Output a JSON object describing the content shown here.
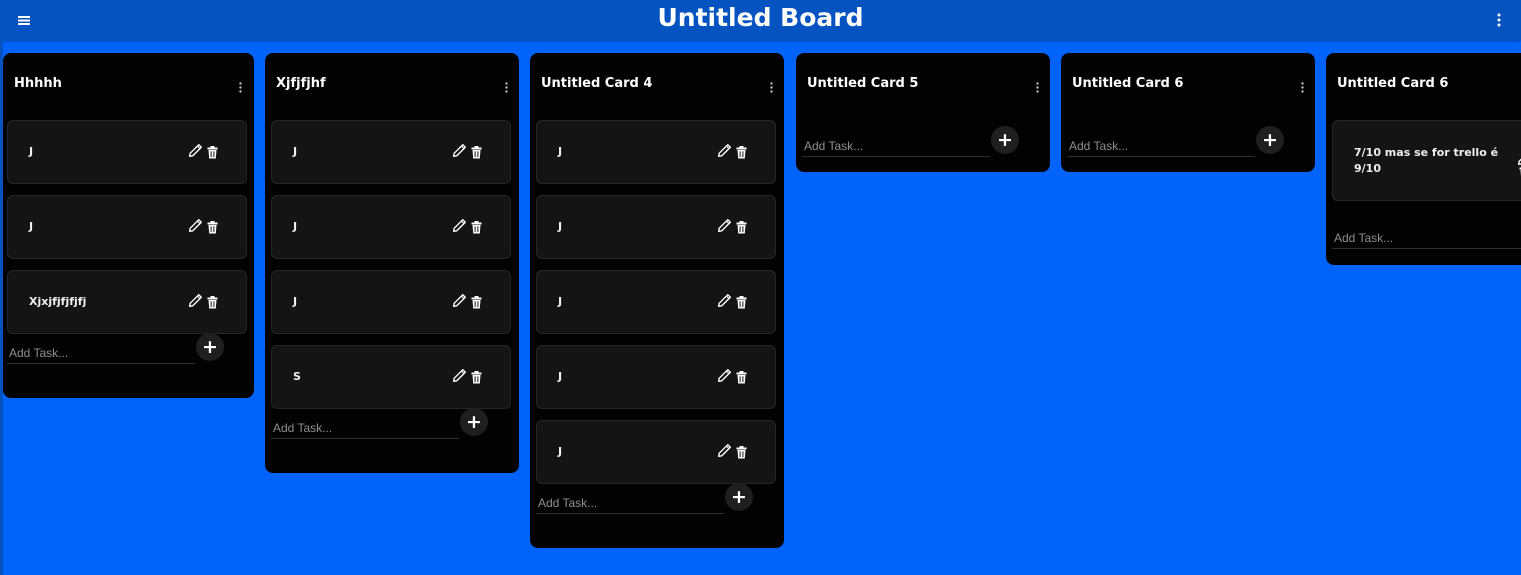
{
  "board": {
    "title": "Untitled Board",
    "menu_icon": "hamburger-icon",
    "options_icon": "kebab-vertical-icon",
    "background": "#0064fb",
    "header_color": "#0453c0"
  },
  "columns": [
    {
      "title": "Hhhhh",
      "tasks": [
        "J",
        "J",
        "Xjxjfjfjfjfj"
      ],
      "add_placeholder": "Add Task..."
    },
    {
      "title": "Xjfjfjhf",
      "tasks": [
        "J",
        "J",
        "J",
        "S"
      ],
      "add_placeholder": "Add Task..."
    },
    {
      "title": "Untitled Card 4",
      "tasks": [
        "J",
        "J",
        "J",
        "J",
        "J"
      ],
      "add_placeholder": "Add Task..."
    },
    {
      "title": "Untitled Card 5",
      "tasks": [],
      "add_placeholder": "Add Task..."
    },
    {
      "title": "Untitled Card 6",
      "tasks": [],
      "add_placeholder": "Add Task..."
    },
    {
      "title": "Untitled Card 6",
      "tasks": [
        "7/10 mas se for trello é 9/10"
      ],
      "add_placeholder": "Add Task..."
    }
  ],
  "icons": {
    "column_menu": "kebab-vertical-icon",
    "edit": "pencil-icon",
    "delete": "trash-icon",
    "add": "plus-icon"
  },
  "add_button_label": "+"
}
